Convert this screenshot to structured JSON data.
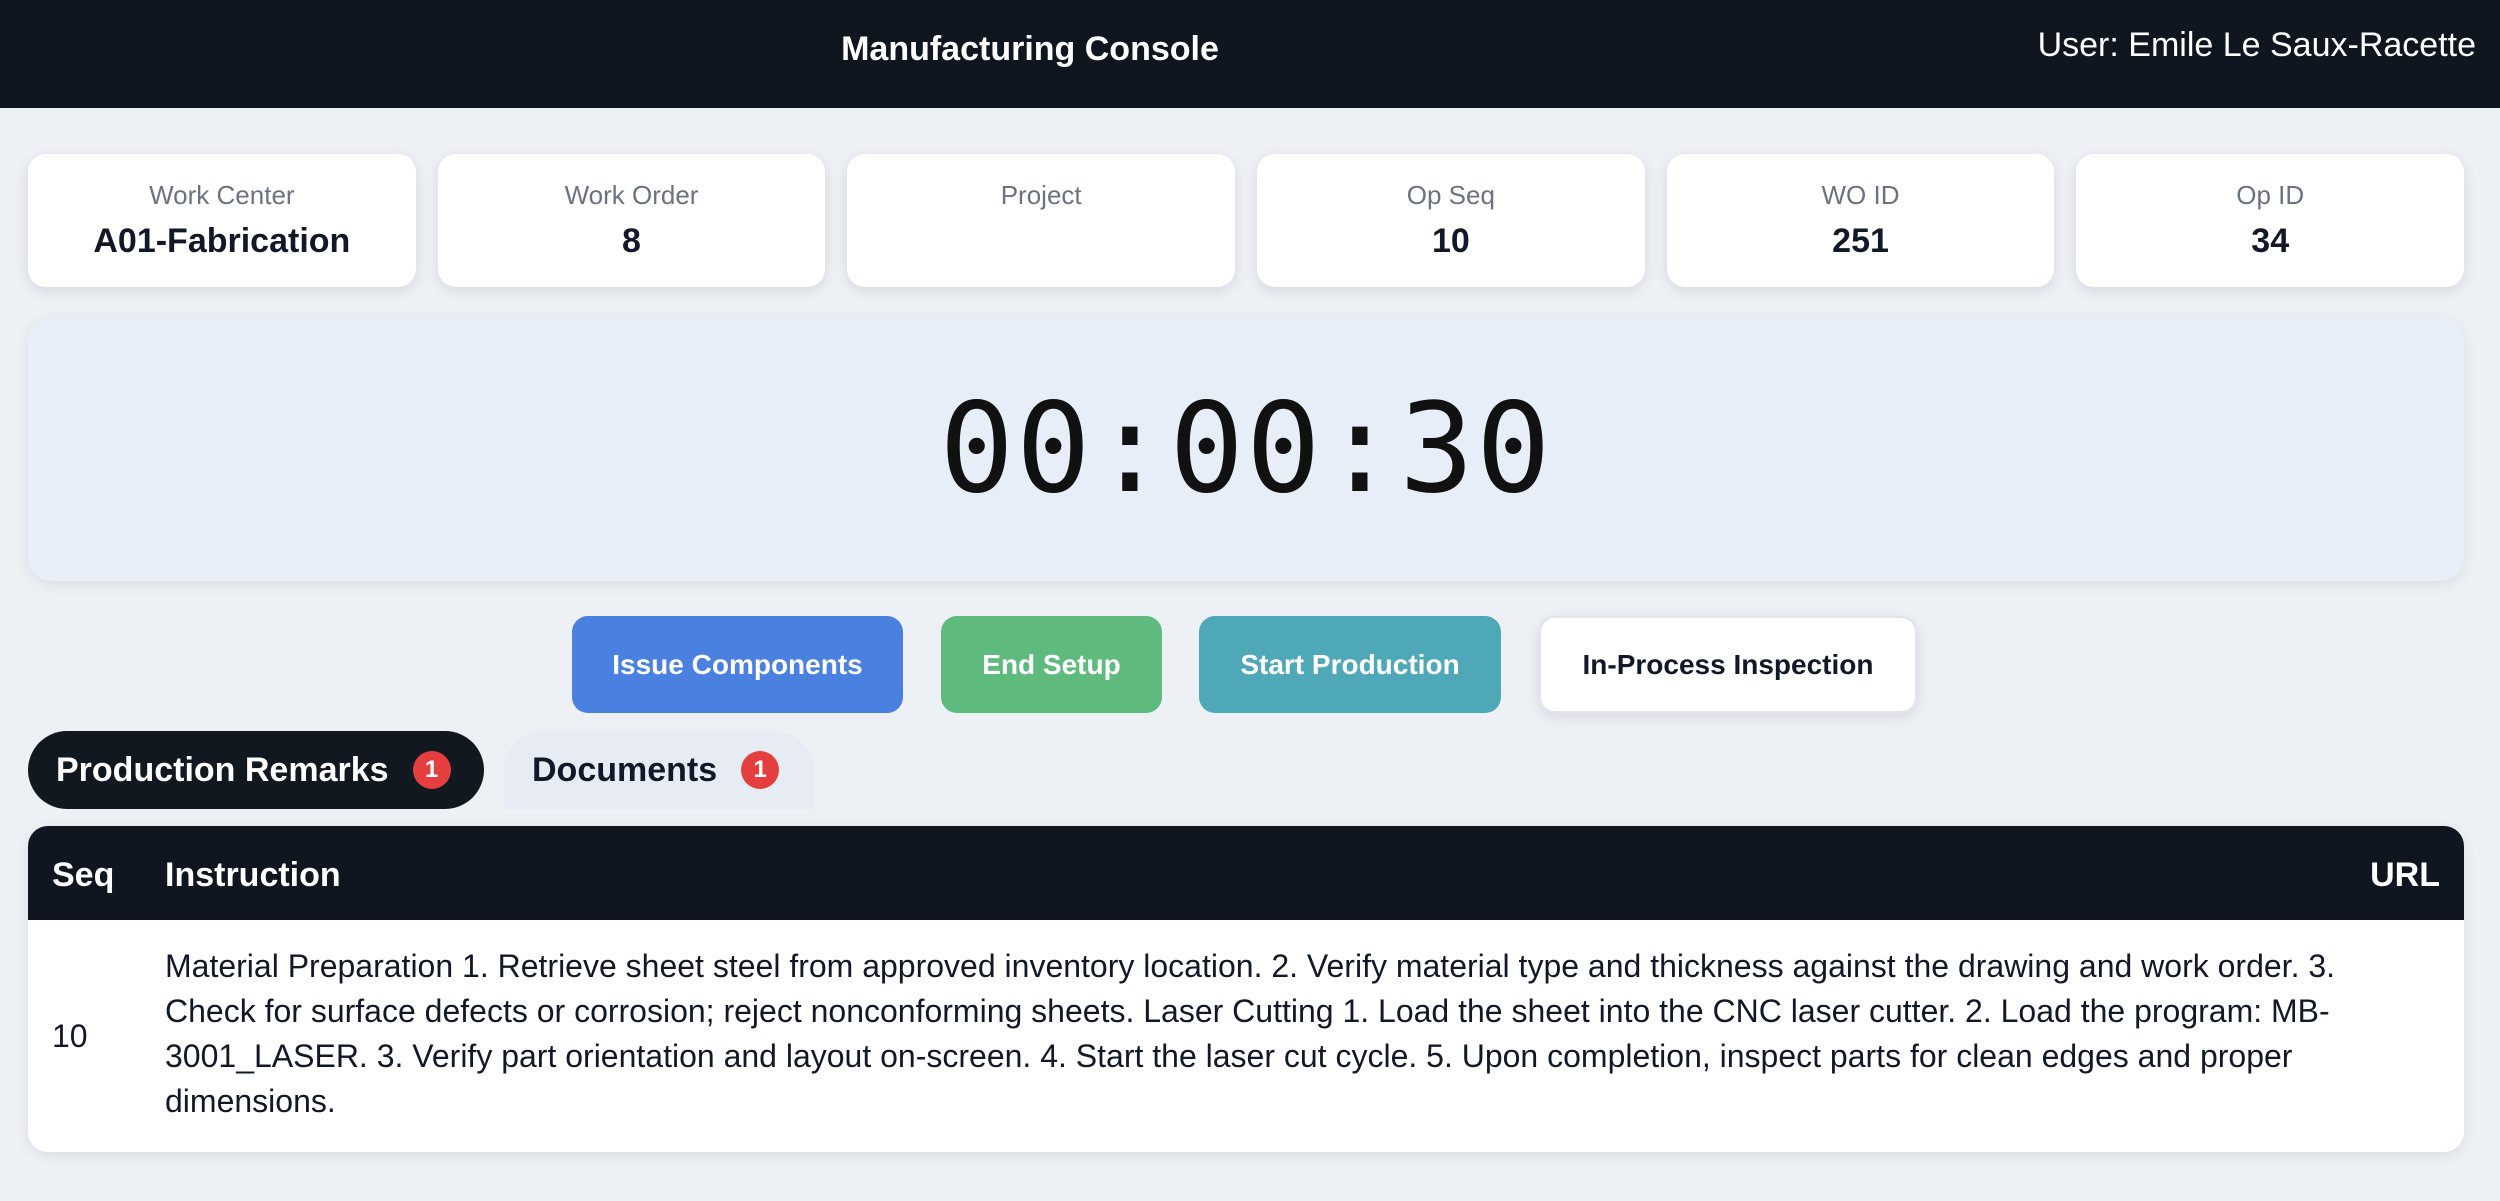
{
  "header": {
    "title": "Manufacturing Console",
    "user": "User: Emile Le Saux-Racette"
  },
  "info_cards": [
    {
      "label": "Work Center",
      "value": "A01-Fabrication"
    },
    {
      "label": "Work Order",
      "value": "8"
    },
    {
      "label": "Project",
      "value": ""
    },
    {
      "label": "Op Seq",
      "value": "10"
    },
    {
      "label": "WO ID",
      "value": "251"
    },
    {
      "label": "Op ID",
      "value": "34"
    }
  ],
  "timer": {
    "value": "00:00:30"
  },
  "actions": {
    "issue_components": "Issue Components",
    "end_setup": "End Setup",
    "start_production": "Start Production",
    "in_process_inspection": "In-Process Inspection"
  },
  "tabs": [
    {
      "label": "Production Remarks",
      "badge": "1",
      "active": true
    },
    {
      "label": "Documents",
      "badge": "1",
      "active": false
    }
  ],
  "table": {
    "headers": {
      "seq": "Seq",
      "instruction": "Instruction",
      "url": "URL"
    },
    "rows": [
      {
        "seq": "10",
        "instruction": "Material Preparation 1. Retrieve sheet steel from approved inventory location. 2. Verify material type and thickness against the drawing and work order. 3. Check for surface defects or corrosion; reject nonconforming sheets. Laser Cutting 1. Load the sheet into the CNC laser cutter. 2. Load the program: MB-3001_LASER. 3. Verify part orientation and layout on-screen. 4. Start the laser cut cycle. 5. Upon completion, inspect parts for clean edges and proper dimensions.",
        "url": ""
      }
    ]
  },
  "colors": {
    "topbar": "#0f1620",
    "issue_button": "#4a80e0",
    "end_setup_button": "#5fba7d",
    "start_production_button": "#4ea8b8",
    "badge": "#e53e3e",
    "timer_panel": "#e8eef8"
  }
}
